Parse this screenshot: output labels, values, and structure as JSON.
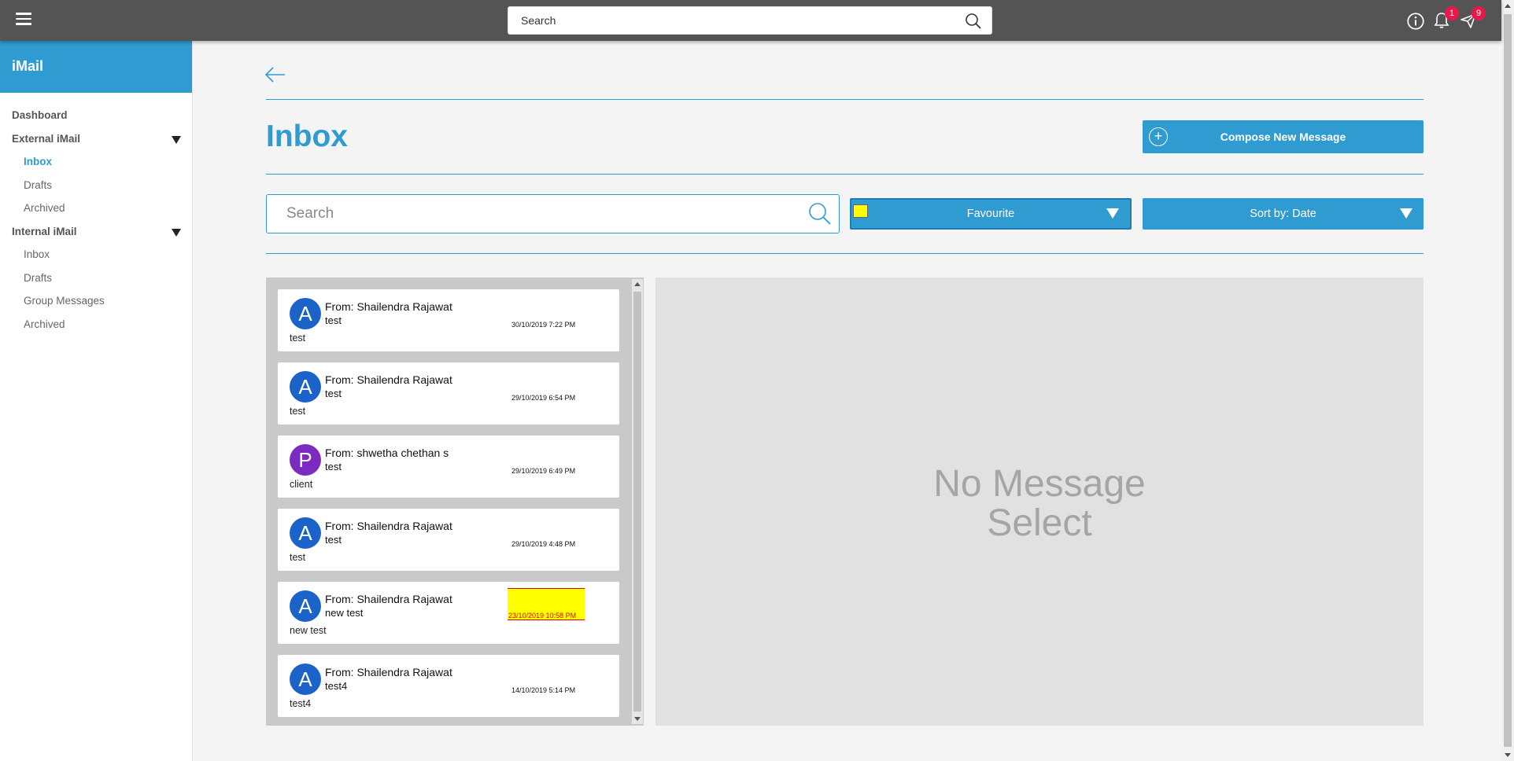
{
  "topbar": {
    "search_placeholder": "Search",
    "notification_count": "1",
    "message_count": "9"
  },
  "sidebar": {
    "brand": "iMail",
    "items": [
      {
        "label": "Dashboard"
      },
      {
        "label": "External iMail"
      },
      {
        "label": "Inbox"
      },
      {
        "label": "Drafts"
      },
      {
        "label": "Archived"
      },
      {
        "label": "Internal iMail"
      },
      {
        "label": "Inbox"
      },
      {
        "label": "Drafts"
      },
      {
        "label": "Group Messages"
      },
      {
        "label": "Archived"
      }
    ]
  },
  "main": {
    "title": "Inbox",
    "compose_label": "Compose New Message",
    "search_placeholder": "Search",
    "filter_label": "Favourite",
    "sort_label": "Sort by: Date",
    "empty_text_line1": "No Message",
    "empty_text_line2": "Select"
  },
  "messages": [
    {
      "initial": "A",
      "from": "From: Shailendra Rajawat",
      "subject": "test",
      "date": "30/10/2019 7:22 PM",
      "preview": "test"
    },
    {
      "initial": "A",
      "from": "From: Shailendra Rajawat",
      "subject": "test",
      "date": "29/10/2019 6:54 PM",
      "preview": "test"
    },
    {
      "initial": "P",
      "from": "From: shwetha chethan s",
      "subject": "test",
      "date": "29/10/2019 6:49 PM",
      "preview": "client"
    },
    {
      "initial": "A",
      "from": "From: Shailendra Rajawat",
      "subject": "test",
      "date": "29/10/2019 4:48 PM",
      "preview": "test"
    },
    {
      "initial": "A",
      "from": "From: Shailendra Rajawat",
      "subject": "new test",
      "date": "23/10/2019 10:58 PM",
      "preview": "new test",
      "favourite": true
    },
    {
      "initial": "A",
      "from": "From: Shailendra Rajawat",
      "subject": "test4",
      "date": "14/10/2019 5:14 PM",
      "preview": "test4"
    }
  ],
  "colors": {
    "accent": "#2f9bd1",
    "topbar": "#545454",
    "badge": "#e8194a",
    "favourite_highlight": "#ffff00",
    "avatar_blue": "#1b63c8",
    "avatar_purple": "#7b2bc0"
  },
  "icons": {
    "menu": "hamburger-icon",
    "search": "search-icon",
    "info": "info-icon",
    "bell": "bell-icon",
    "send": "send-icon",
    "back": "arrow-left-icon",
    "add": "plus-circle-icon",
    "dropdown": "caret-down-icon"
  }
}
